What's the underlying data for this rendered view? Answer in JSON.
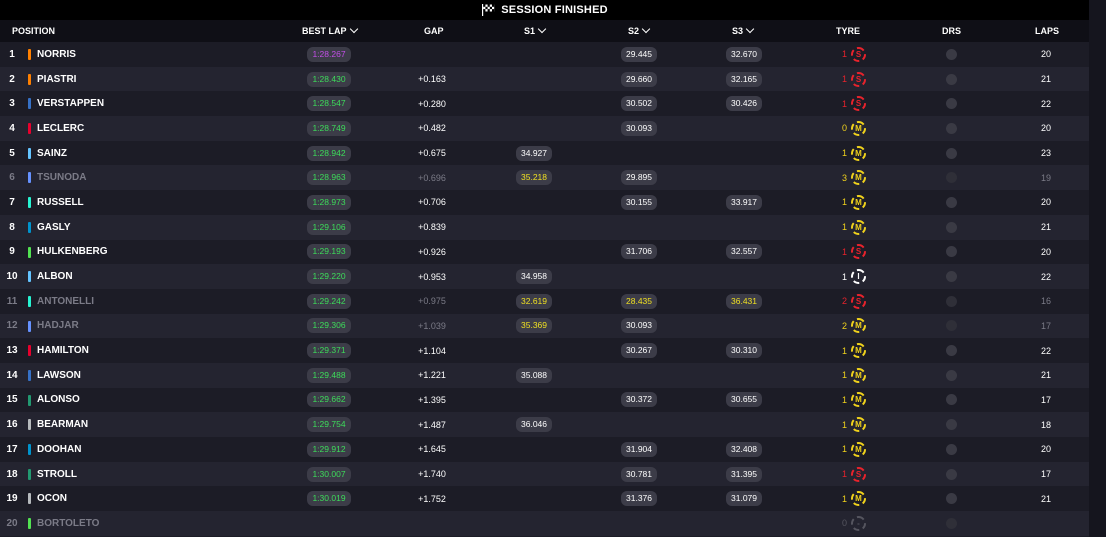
{
  "banner": {
    "title": "SESSION FINISHED",
    "icon": "checkered-flag-icon"
  },
  "columns": {
    "position": "POSITION",
    "best_lap": "BEST LAP",
    "gap": "GAP",
    "s1": "S1",
    "s2": "S2",
    "s3": "S3",
    "tyre": "TYRE",
    "drs": "DRS",
    "laps": "LAPS"
  },
  "colors": {
    "purple_best": "#c34ee8",
    "green_best": "#3ddc5a",
    "yellow_sector": "#f0e022",
    "soft": "#e8232c",
    "medium": "#f0d21c",
    "intermediate": "#ffffff"
  },
  "rows": [
    {
      "pos": "1",
      "name": "NORRIS",
      "team_color": "#ff8000",
      "best": "1:28.267",
      "best_color": "purple",
      "gap": "",
      "s1": "",
      "s1_color": "",
      "s2": "29.445",
      "s2_color": "white",
      "s3": "32.670",
      "s3_color": "white",
      "tyre_count": "1",
      "tyre_count_color": "#e8232c",
      "tyre": "S",
      "laps": "20",
      "dim": false
    },
    {
      "pos": "2",
      "name": "PIASTRI",
      "team_color": "#ff8000",
      "best": "1:28.430",
      "best_color": "green",
      "gap": "+0.163",
      "s1": "",
      "s1_color": "",
      "s2": "29.660",
      "s2_color": "white",
      "s3": "32.165",
      "s3_color": "white",
      "tyre_count": "1",
      "tyre_count_color": "#e8232c",
      "tyre": "S",
      "laps": "21",
      "dim": false
    },
    {
      "pos": "3",
      "name": "VERSTAPPEN",
      "team_color": "#3671c6",
      "best": "1:28.547",
      "best_color": "green",
      "gap": "+0.280",
      "s1": "",
      "s1_color": "",
      "s2": "30.502",
      "s2_color": "white",
      "s3": "30.426",
      "s3_color": "white",
      "tyre_count": "1",
      "tyre_count_color": "#e8232c",
      "tyre": "S",
      "laps": "22",
      "dim": false
    },
    {
      "pos": "4",
      "name": "LECLERC",
      "team_color": "#e8002d",
      "best": "1:28.749",
      "best_color": "green",
      "gap": "+0.482",
      "s1": "",
      "s1_color": "",
      "s2": "30.093",
      "s2_color": "white",
      "s3": "",
      "s3_color": "",
      "tyre_count": "0",
      "tyre_count_color": "#f0d21c",
      "tyre": "M",
      "laps": "20",
      "dim": false
    },
    {
      "pos": "5",
      "name": "SAINZ",
      "team_color": "#64c4ff",
      "best": "1:28.942",
      "best_color": "green",
      "gap": "+0.675",
      "s1": "34.927",
      "s1_color": "white",
      "s2": "",
      "s2_color": "",
      "s3": "",
      "s3_color": "",
      "tyre_count": "1",
      "tyre_count_color": "#f0d21c",
      "tyre": "M",
      "laps": "23",
      "dim": false
    },
    {
      "pos": "6",
      "name": "TSUNODA",
      "team_color": "#6692ff",
      "best": "1:28.963",
      "best_color": "green",
      "gap": "+0.696",
      "s1": "35.218",
      "s1_color": "yellow",
      "s2": "29.895",
      "s2_color": "white",
      "s3": "",
      "s3_color": "",
      "tyre_count": "3",
      "tyre_count_color": "#f0d21c",
      "tyre": "M",
      "laps": "19",
      "dim": true
    },
    {
      "pos": "7",
      "name": "RUSSELL",
      "team_color": "#27f4d2",
      "best": "1:28.973",
      "best_color": "green",
      "gap": "+0.706",
      "s1": "",
      "s1_color": "",
      "s2": "30.155",
      "s2_color": "white",
      "s3": "33.917",
      "s3_color": "white",
      "tyre_count": "1",
      "tyre_count_color": "#f0d21c",
      "tyre": "M",
      "laps": "20",
      "dim": false
    },
    {
      "pos": "8",
      "name": "GASLY",
      "team_color": "#0093cc",
      "best": "1:29.106",
      "best_color": "green",
      "gap": "+0.839",
      "s1": "",
      "s1_color": "",
      "s2": "",
      "s2_color": "",
      "s3": "",
      "s3_color": "",
      "tyre_count": "1",
      "tyre_count_color": "#f0d21c",
      "tyre": "M",
      "laps": "21",
      "dim": false
    },
    {
      "pos": "9",
      "name": "HULKENBERG",
      "team_color": "#52e252",
      "best": "1:29.193",
      "best_color": "green",
      "gap": "+0.926",
      "s1": "",
      "s1_color": "",
      "s2": "31.706",
      "s2_color": "white",
      "s3": "32.557",
      "s3_color": "white",
      "tyre_count": "1",
      "tyre_count_color": "#e8232c",
      "tyre": "S",
      "laps": "20",
      "dim": false
    },
    {
      "pos": "10",
      "name": "ALBON",
      "team_color": "#64c4ff",
      "best": "1:29.220",
      "best_color": "green",
      "gap": "+0.953",
      "s1": "34.958",
      "s1_color": "white",
      "s2": "",
      "s2_color": "",
      "s3": "",
      "s3_color": "",
      "tyre_count": "1",
      "tyre_count_color": "#ffffff",
      "tyre": "I",
      "laps": "22",
      "dim": false
    },
    {
      "pos": "11",
      "name": "ANTONELLI",
      "team_color": "#27f4d2",
      "best": "1:29.242",
      "best_color": "green",
      "gap": "+0.975",
      "s1": "32.619",
      "s1_color": "yellow",
      "s2": "28.435",
      "s2_color": "yellow",
      "s3": "36.431",
      "s3_color": "yellow",
      "tyre_count": "2",
      "tyre_count_color": "#e8232c",
      "tyre": "S",
      "laps": "16",
      "dim": true
    },
    {
      "pos": "12",
      "name": "HADJAR",
      "team_color": "#6692ff",
      "best": "1:29.306",
      "best_color": "green",
      "gap": "+1.039",
      "s1": "35.369",
      "s1_color": "yellow",
      "s2": "30.093",
      "s2_color": "white",
      "s3": "",
      "s3_color": "",
      "tyre_count": "2",
      "tyre_count_color": "#f0d21c",
      "tyre": "M",
      "laps": "17",
      "dim": true
    },
    {
      "pos": "13",
      "name": "HAMILTON",
      "team_color": "#e8002d",
      "best": "1:29.371",
      "best_color": "green",
      "gap": "+1.104",
      "s1": "",
      "s1_color": "",
      "s2": "30.267",
      "s2_color": "white",
      "s3": "30.310",
      "s3_color": "white",
      "tyre_count": "1",
      "tyre_count_color": "#f0d21c",
      "tyre": "M",
      "laps": "22",
      "dim": false
    },
    {
      "pos": "14",
      "name": "LAWSON",
      "team_color": "#3671c6",
      "best": "1:29.488",
      "best_color": "green",
      "gap": "+1.221",
      "s1": "35.088",
      "s1_color": "white",
      "s2": "",
      "s2_color": "",
      "s3": "",
      "s3_color": "",
      "tyre_count": "1",
      "tyre_count_color": "#f0d21c",
      "tyre": "M",
      "laps": "21",
      "dim": false
    },
    {
      "pos": "15",
      "name": "ALONSO",
      "team_color": "#229971",
      "best": "1:29.662",
      "best_color": "green",
      "gap": "+1.395",
      "s1": "",
      "s1_color": "",
      "s2": "30.372",
      "s2_color": "white",
      "s3": "30.655",
      "s3_color": "white",
      "tyre_count": "1",
      "tyre_count_color": "#f0d21c",
      "tyre": "M",
      "laps": "17",
      "dim": false
    },
    {
      "pos": "16",
      "name": "BEARMAN",
      "team_color": "#b6babd",
      "best": "1:29.754",
      "best_color": "green",
      "gap": "+1.487",
      "s1": "36.046",
      "s1_color": "white",
      "s2": "",
      "s2_color": "",
      "s3": "",
      "s3_color": "",
      "tyre_count": "1",
      "tyre_count_color": "#f0d21c",
      "tyre": "M",
      "laps": "18",
      "dim": false
    },
    {
      "pos": "17",
      "name": "DOOHAN",
      "team_color": "#0093cc",
      "best": "1:29.912",
      "best_color": "green",
      "gap": "+1.645",
      "s1": "",
      "s1_color": "",
      "s2": "31.904",
      "s2_color": "white",
      "s3": "32.408",
      "s3_color": "white",
      "tyre_count": "1",
      "tyre_count_color": "#f0d21c",
      "tyre": "M",
      "laps": "20",
      "dim": false
    },
    {
      "pos": "18",
      "name": "STROLL",
      "team_color": "#229971",
      "best": "1:30.007",
      "best_color": "green",
      "gap": "+1.740",
      "s1": "",
      "s1_color": "",
      "s2": "30.781",
      "s2_color": "white",
      "s3": "31.395",
      "s3_color": "white",
      "tyre_count": "1",
      "tyre_count_color": "#e8232c",
      "tyre": "S",
      "laps": "17",
      "dim": false
    },
    {
      "pos": "19",
      "name": "OCON",
      "team_color": "#b6babd",
      "best": "1:30.019",
      "best_color": "green",
      "gap": "+1.752",
      "s1": "",
      "s1_color": "",
      "s2": "31.376",
      "s2_color": "white",
      "s3": "31.079",
      "s3_color": "white",
      "tyre_count": "1",
      "tyre_count_color": "#f0d21c",
      "tyre": "M",
      "laps": "21",
      "dim": false
    },
    {
      "pos": "20",
      "name": "BORTOLETO",
      "team_color": "#52e252",
      "best": "",
      "best_color": "",
      "gap": "",
      "s1": "",
      "s1_color": "",
      "s2": "",
      "s2_color": "",
      "s3": "",
      "s3_color": "",
      "tyre_count": "0",
      "tyre_count_color": "#55555f",
      "tyre": "N",
      "laps": "",
      "dim": true
    }
  ]
}
